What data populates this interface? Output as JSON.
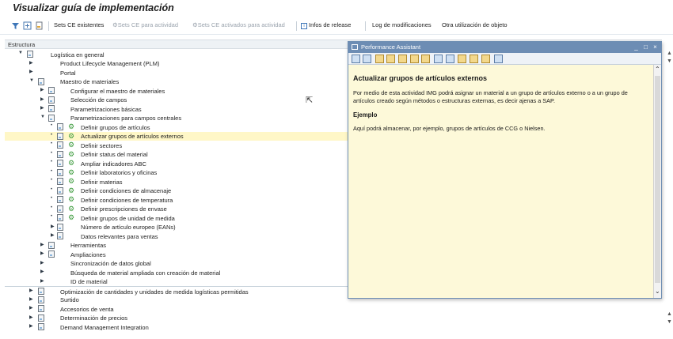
{
  "title": "Visualizar guía de implementación",
  "toolbar": {
    "sets_existentes": "Sets CE existentes",
    "sets_actividad": "Sets CE para actividad",
    "sets_activados": "Sets CE activados para actividad",
    "infos_release": "Infos de release",
    "log_modificaciones": "Log de modificaciones",
    "otra_utilizacion": "Otra utilización de objeto"
  },
  "tree": {
    "header": "Estructura",
    "rows": [
      {
        "label": "Logística en general"
      },
      {
        "label": "Product Lifecycle Management (PLM)"
      },
      {
        "label": "Portal"
      },
      {
        "label": "Maestro de materiales"
      },
      {
        "label": "Configurar el maestro de materiales"
      },
      {
        "label": "Selección de campos"
      },
      {
        "label": "Parametrizaciones básicas"
      },
      {
        "label": "Parametrizaciones para campos centrales"
      },
      {
        "label": "Definir grupos de artículos"
      },
      {
        "label": "Actualizar grupos de artículos externos"
      },
      {
        "label": "Definir sectores"
      },
      {
        "label": "Definir status del material"
      },
      {
        "label": "Ampliar indicadores ABC"
      },
      {
        "label": "Definir laboratorios y oficinas"
      },
      {
        "label": "Definir materias"
      },
      {
        "label": "Definir condiciones de almacenaje"
      },
      {
        "label": "Definir condiciones de temperatura"
      },
      {
        "label": "Definir prescripciones de envase"
      },
      {
        "label": "Definir grupos de unidad de medida"
      },
      {
        "label": "Número de artículo europeo (EANs)"
      },
      {
        "label": "Datos relevantes para ventas"
      },
      {
        "label": "Herramientas"
      },
      {
        "label": "Ampliaciones"
      },
      {
        "label": "Sincronización de datos global"
      },
      {
        "label": "Búsqueda de material ampliada con creación de material"
      },
      {
        "label": "ID de material"
      },
      {
        "label": "Optimización de cantidades y unidades de medida logísticas permitidas"
      },
      {
        "label": "Surtido"
      },
      {
        "label": "Accesorios de venta"
      },
      {
        "label": "Determinación de precios"
      },
      {
        "label": "Demand Management Integration"
      }
    ]
  },
  "assistant": {
    "window_title": "Performance Assistant",
    "heading": "Actualizar grupos de artículos externos",
    "paragraph": "Por medio de esta actividad IMG podrá asignar un material a un grupo de artículos externo o a un grupo de artículos creado según métodos o estructuras externas, es decir ajenas a SAP.",
    "example_heading": "Ejemplo",
    "example_text": "Aquí podrá almacenar, por ejemplo, grupos de artículos de CCG o Nielsen."
  }
}
